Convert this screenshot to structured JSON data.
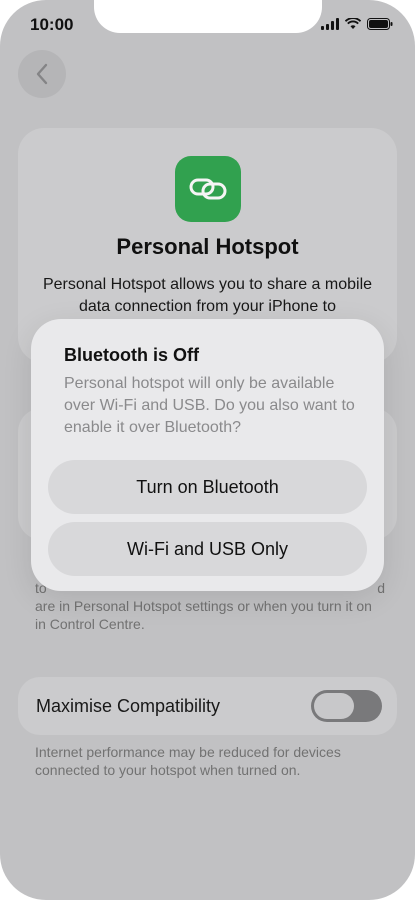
{
  "status_bar": {
    "time": "10:00"
  },
  "page": {
    "title": "Personal Hotspot",
    "description": "Personal Hotspot allows you to share a mobile data connection from your iPhone to",
    "help_text_line1_left": "to",
    "help_text_line1_right": "d",
    "help_text_line2": "are in Personal Hotspot settings or when you turn it on in Control Centre.",
    "compat_label": "Maximise Compatibility",
    "compat_toggle_state": "off",
    "compat_note": "Internet performance may be reduced for devices connected to your hotspot when turned on."
  },
  "dialog": {
    "title": "Bluetooth is Off",
    "body": "Personal hotspot will only be available over Wi-Fi and USB. Do you also want to enable it over Bluetooth?",
    "buttons": [
      {
        "label": "Turn on Bluetooth"
      },
      {
        "label": "Wi-Fi and USB Only"
      }
    ]
  },
  "icons": {
    "back": "chevron-left-icon",
    "app": "link-icon",
    "signal": "signal-icon",
    "wifi": "wifi-icon",
    "battery": "battery-icon"
  },
  "colors": {
    "app_icon_bg": "#34a853",
    "background": "#c9c9cb",
    "dialog_bg": "#e9e9eb"
  }
}
